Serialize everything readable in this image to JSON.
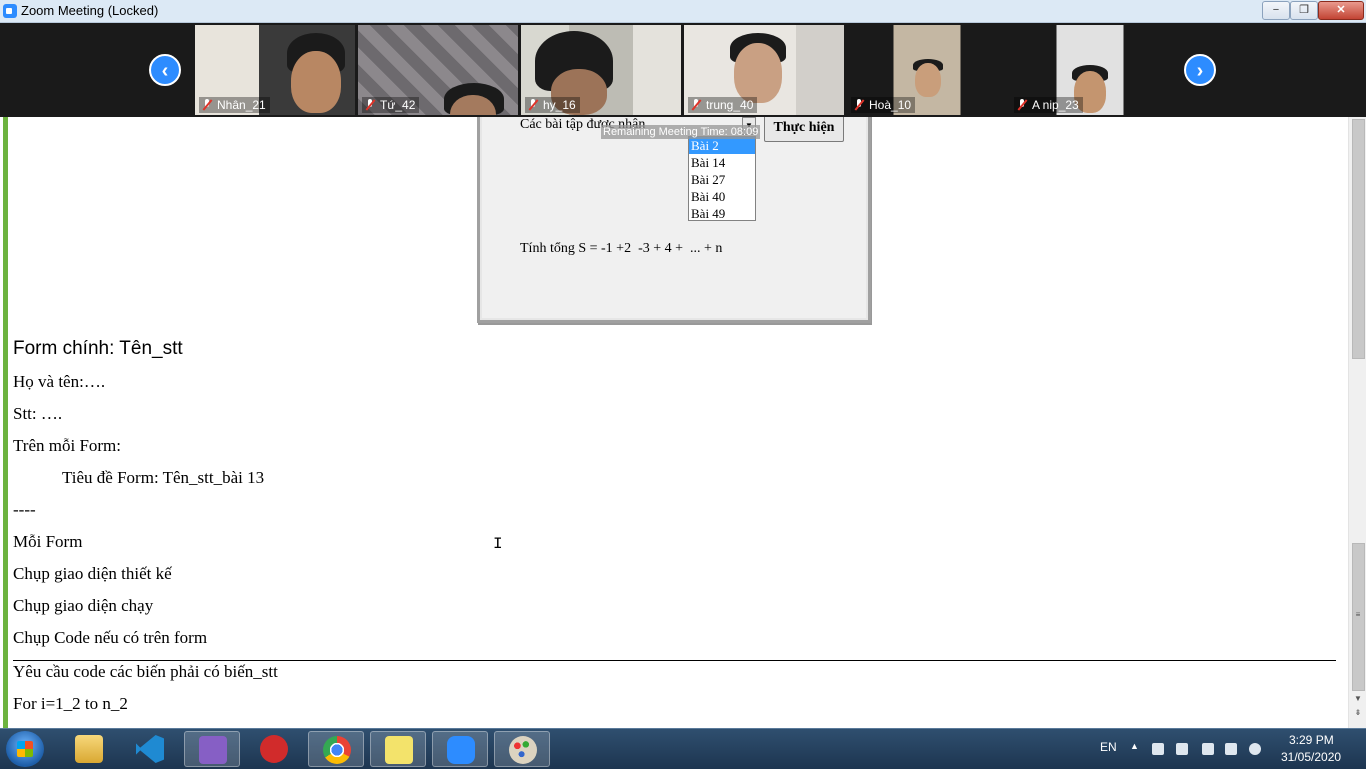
{
  "window": {
    "title": "Zoom Meeting (Locked)",
    "minimize": "−",
    "restore": "❐",
    "close": "✕"
  },
  "participants": [
    {
      "name": "Nhân_21"
    },
    {
      "name": "Tứ_42"
    },
    {
      "name": "hy_16"
    },
    {
      "name": "trung_40"
    },
    {
      "name": "Hoà_10"
    },
    {
      "name": "A nip_23"
    }
  ],
  "strip": {
    "prev": "‹",
    "next": "›"
  },
  "form_preview": {
    "label": "Các bài tập được nhận",
    "execute_button": "Thực hiện",
    "tooltip": "Remaining Meeting Time: 08:09",
    "options": [
      "Bài 2",
      "Bài 14",
      "Bài 27",
      "Bài 40",
      "Bài 49"
    ],
    "selected_option": "Bài 2",
    "formula": "Tính tổng S = -1 +2  -3 + 4 +  ... + n"
  },
  "document": {
    "heading": "Form chính: Tên_stt",
    "lines": [
      "Họ và tên:….",
      "Stt: ….",
      "Trên mỗi Form:",
      "Tiêu đề Form: Tên_stt_bài 13",
      "----",
      "Mỗi Form",
      "Chụp giao diện thiết kế",
      "Chụp giao diện chạy",
      "Chụp Code nếu có trên form",
      "Yêu cầu code các biến phải có biến_stt",
      "For i=1_2 to n_2"
    ]
  },
  "taskbar": {
    "language": "EN",
    "time": "3:29 PM",
    "date": "31/05/2020",
    "apps": [
      "file-explorer",
      "vs-code",
      "visual-studio",
      "garena",
      "chrome",
      "sticky-notes",
      "zoom",
      "paint"
    ]
  }
}
